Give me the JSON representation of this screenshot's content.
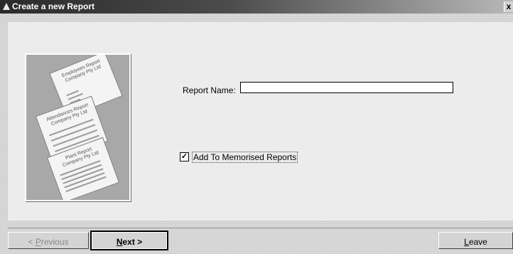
{
  "window": {
    "title": "Create a new Report",
    "close_label": "x"
  },
  "illustration": {
    "paper1_title": "Employees Report Company Pty Ltd",
    "paper2_title": "Attendances Report Company Pty Ltd",
    "paper3_title": "Plant Report Company Pty Ltd"
  },
  "form": {
    "report_name_label": "Report Name:",
    "report_name_value": "",
    "memorise_label": "Add To Memorised Reports",
    "memorise_checked": true,
    "memorise_mark": "✓"
  },
  "buttons": {
    "previous_prefix": "< ",
    "previous_mnemonic": "P",
    "previous_rest": "revious",
    "next_mnemonic": "N",
    "next_rest": "ext >",
    "leave_mnemonic": "L",
    "leave_rest": "eave"
  }
}
